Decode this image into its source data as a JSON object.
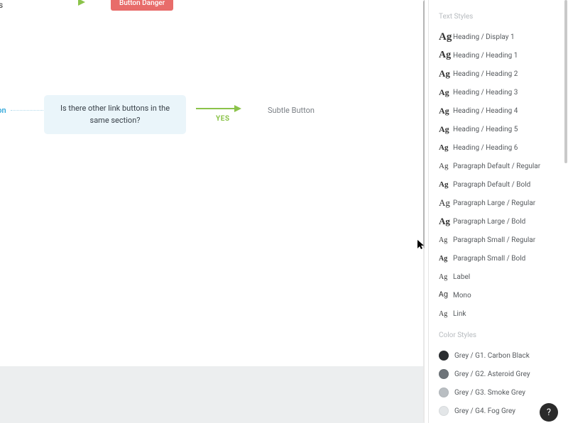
{
  "canvas": {
    "top_letter": "s",
    "danger_button_label": "Button Danger",
    "link_stub_label": "tton",
    "question_text": "Is there other link buttons in the same section?",
    "yes_label": "YES",
    "subtle_label": "Subtle Button"
  },
  "panel": {
    "text_section_title": "Text Styles",
    "color_section_title": "Color Styles",
    "text_styles": [
      {
        "ag_class": "sz-18",
        "name": "Heading / Display 1"
      },
      {
        "ag_class": "sz-17",
        "name": "Heading / Heading 1"
      },
      {
        "ag_class": "sz-16",
        "name": "Heading / Heading 2"
      },
      {
        "ag_class": "sz-15",
        "name": "Heading / Heading 3"
      },
      {
        "ag_class": "sz-15",
        "name": "Heading / Heading 4"
      },
      {
        "ag_class": "sz-14",
        "name": "Heading / Heading 5"
      },
      {
        "ag_class": "sz-13",
        "name": "Heading / Heading 6"
      },
      {
        "ag_class": "sz-12",
        "name": "Paragraph Default / Regular"
      },
      {
        "ag_class": "sz-12 sz-bold",
        "name": "Paragraph Default / Bold"
      },
      {
        "ag_class": "sz-12 sz-lg",
        "name": "Paragraph Large / Regular"
      },
      {
        "ag_class": "sz-12 sz-lg sz-bold",
        "name": "Paragraph Large / Bold"
      },
      {
        "ag_class": "sz-12 sz-sm",
        "name": "Paragraph Small / Regular"
      },
      {
        "ag_class": "sz-12 sz-sm sz-bold",
        "name": "Paragraph Small / Bold"
      },
      {
        "ag_class": "sz-12 sz-sm",
        "name": "Label"
      },
      {
        "ag_class": "mono",
        "name": "Mono"
      },
      {
        "ag_class": "sz-12 sz-sm",
        "name": "Link"
      }
    ],
    "color_styles": [
      {
        "hex": "#2b2e31",
        "name": "Grey / G1. Carbon Black"
      },
      {
        "hex": "#6e7479",
        "name": "Grey / G2. Asteroid Grey"
      },
      {
        "hex": "#b9bec2",
        "name": "Grey / G3. Smoke Grey"
      },
      {
        "hex": "#e3e6e8",
        "name": "Grey / G4. Fog Grey"
      }
    ]
  },
  "help_label": "?"
}
